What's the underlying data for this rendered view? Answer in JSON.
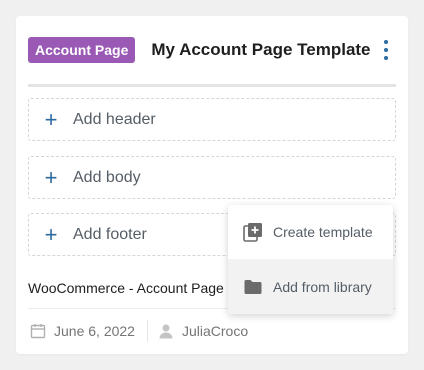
{
  "card": {
    "badge": "Account Page",
    "title": "My Account Page Template",
    "slots": [
      {
        "label": "Add header"
      },
      {
        "label": "Add body"
      },
      {
        "label": "Add footer"
      }
    ],
    "template_name": "WooCommerce - Account Page",
    "date": "June 6, 2022",
    "author": "JuliaCroco"
  },
  "menu": {
    "items": [
      {
        "label": "Create template",
        "icon": "add-template-icon"
      },
      {
        "label": "Add from library",
        "icon": "folder-icon"
      }
    ]
  },
  "colors": {
    "badge": "#9b59b6",
    "accent": "#2d6a9f"
  }
}
